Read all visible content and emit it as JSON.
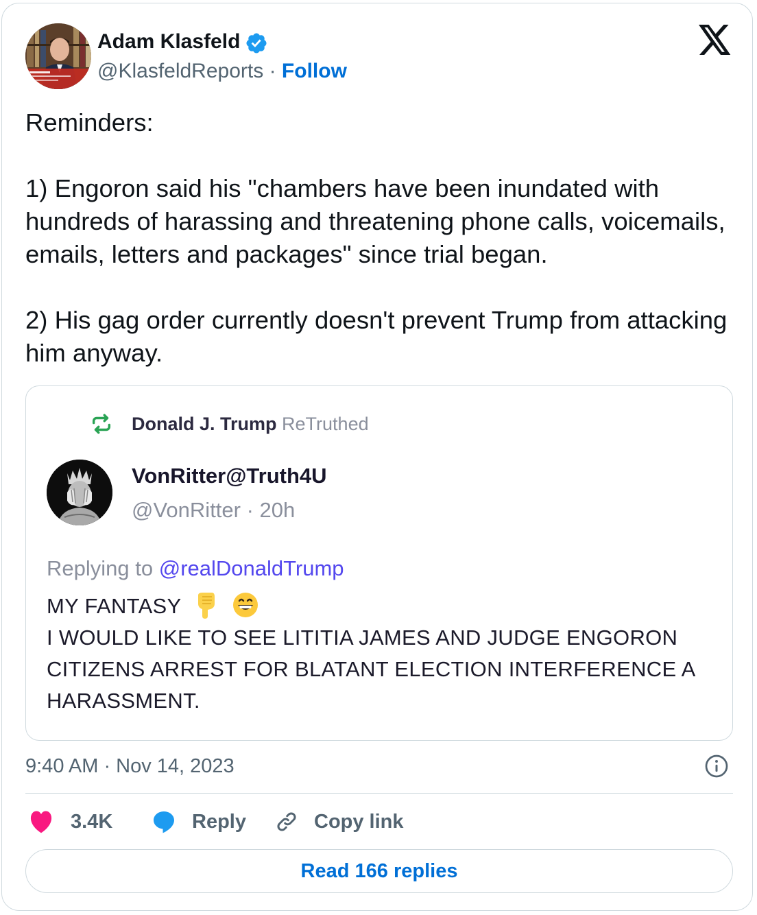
{
  "tweet": {
    "author_name": "Adam Klasfeld",
    "handle": "@KlasfeldReports",
    "separator": "·",
    "follow_label": "Follow",
    "text": "Reminders:\n\n1) Engoron said his \"chambers have been inundated with hundreds of harassing and threatening phone calls, voicemails, emails, letters and packages\" since trial began.\n\n2) His gag order currently doesn't prevent Trump from attacking him anyway.",
    "timestamp": "9:40 AM · Nov 14, 2023",
    "likes": "3.4K",
    "reply_label": "Reply",
    "copy_link_label": "Copy link",
    "read_replies_label": "Read 166 replies"
  },
  "quote": {
    "retruth_by": "Donald J. Trump",
    "retruth_label": "ReTruthed",
    "name": "VonRitter@Truth4U",
    "handle": "@VonRitter",
    "age": "· 20h",
    "replying_prefix": "Replying to",
    "replying_to": "@realDonaldTrump",
    "body_line1": "MY FANTASY",
    "body_line2": "I WOULD LIKE TO SEE LITITIA JAMES AND JUDGE ENGORON",
    "body_line3": "CITIZENS ARREST FOR BLATANT ELECTION INTERFERENCE A",
    "body_line4": "HARASSMENT.",
    "body_emojis": [
      "pointing-down-emoji",
      "grinning-face-emoji"
    ]
  },
  "colors": {
    "brand_blue": "#006fd6",
    "like_red": "#f91880",
    "reply_blue": "#1d9bf0",
    "retruth_green": "#29a354",
    "truth_link": "#5448ee",
    "secondary_text": "#536471",
    "border": "#cfd9de"
  },
  "icons": {
    "verified": "verified-badge-icon",
    "platform": "x-logo-icon",
    "retruth": "retruth-icon",
    "info": "info-icon",
    "like": "heart-icon",
    "reply": "speech-bubble-icon",
    "copy": "link-icon"
  }
}
